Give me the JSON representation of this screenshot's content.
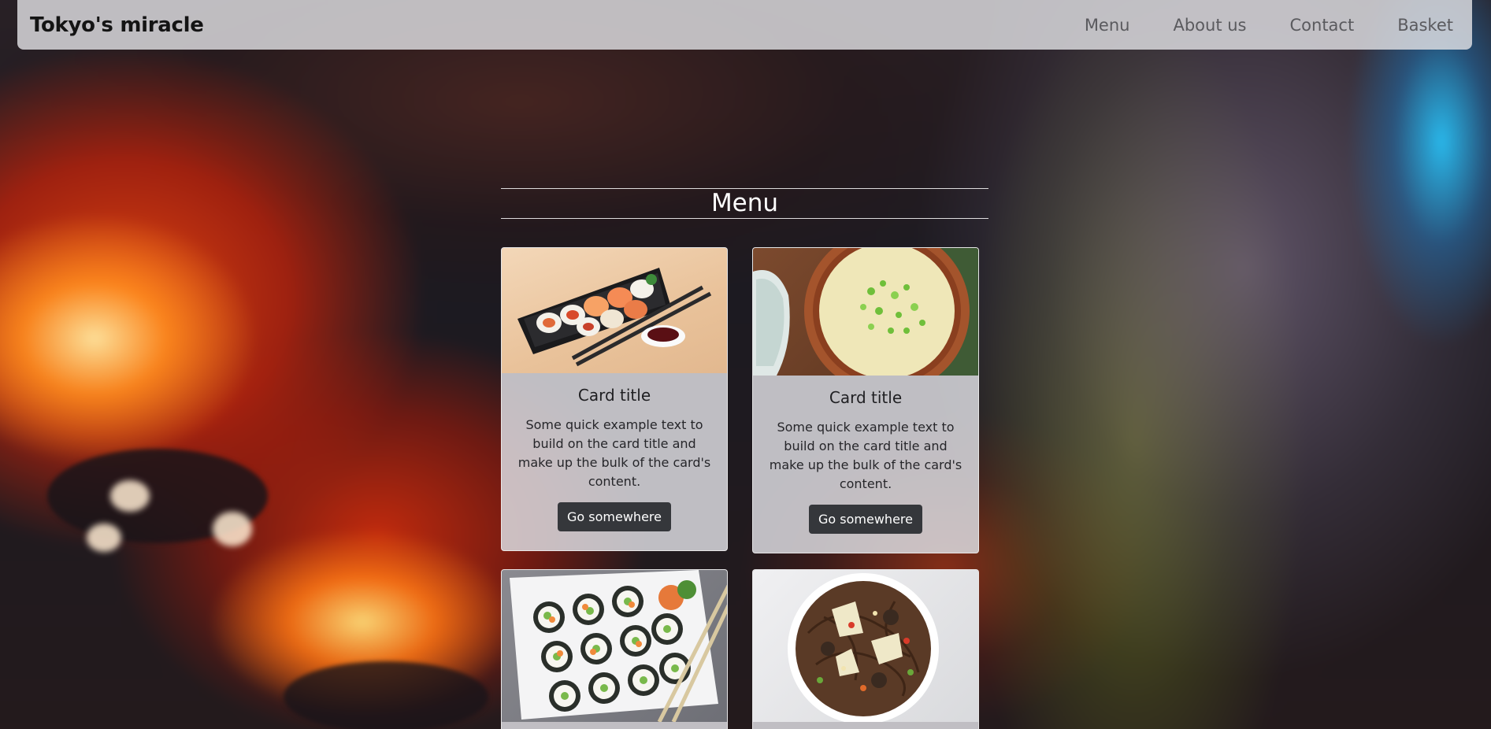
{
  "navbar": {
    "brand": "Tokyo's miracle",
    "links": [
      "Menu",
      "About us",
      "Contact",
      "Basket"
    ]
  },
  "menu": {
    "heading": "Menu",
    "cards": [
      {
        "image": "sushi-tray-photo",
        "title": "Card title",
        "text": "Some quick example text to build on the card title and make up the bulk of the card's content.",
        "button": "Go somewhere"
      },
      {
        "image": "miso-soup-photo",
        "title": "Card title",
        "text": "Some quick example text to build on the card title and make up the bulk of the card's content.",
        "button": "Go somewhere"
      },
      {
        "image": "sushi-rolls-photo"
      },
      {
        "image": "noodles-photo"
      }
    ]
  },
  "colors": {
    "navbar_bg": "#e1e1e4",
    "button_bg": "#35373b",
    "heading_text": "#ffffff"
  }
}
